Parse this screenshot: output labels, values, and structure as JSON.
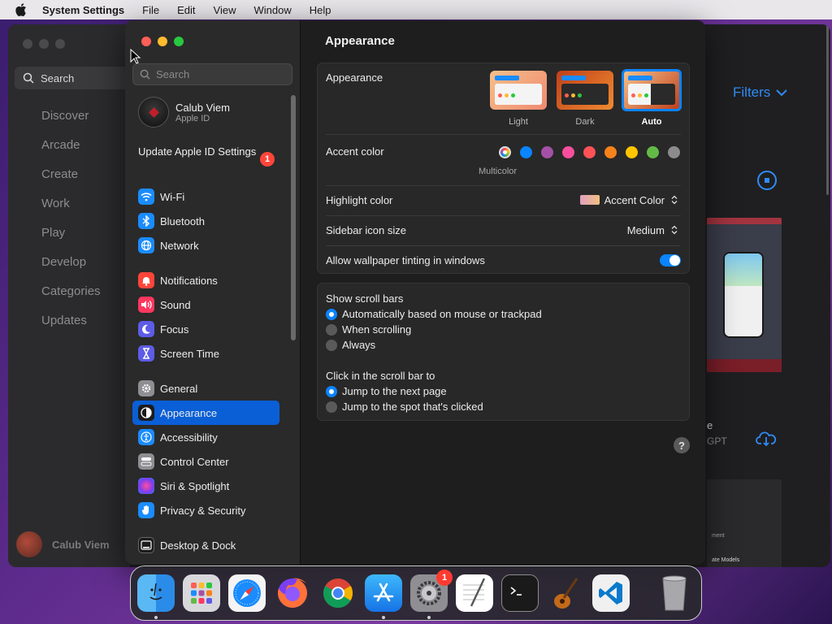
{
  "menubar": {
    "app_name": "System Settings",
    "items": [
      "File",
      "Edit",
      "View",
      "Window",
      "Help"
    ]
  },
  "background_window": {
    "search_label": "Search",
    "nav": [
      "Discover",
      "Arcade",
      "Create",
      "Work",
      "Play",
      "Develop",
      "Categories",
      "Updates"
    ],
    "user_name": "Calub Viem",
    "filters_label": "Filters",
    "partial_text_1": "e",
    "partial_text_2": "GPT",
    "card_text_1": "ment",
    "card_text_2": "ate Models"
  },
  "sidebar": {
    "search_placeholder": "Search",
    "profile": {
      "name": "Calub Viem",
      "subtitle": "Apple ID"
    },
    "update": {
      "label": "Update Apple ID Settings",
      "badge": "1"
    },
    "group1": [
      {
        "label": "Wi-Fi",
        "icon": "wifi-icon",
        "color": "#1a8cff"
      },
      {
        "label": "Bluetooth",
        "icon": "bluetooth-icon",
        "color": "#1a8cff"
      },
      {
        "label": "Network",
        "icon": "globe-icon",
        "color": "#1a8cff"
      }
    ],
    "group2": [
      {
        "label": "Notifications",
        "icon": "bell-icon",
        "color": "#ff453a"
      },
      {
        "label": "Sound",
        "icon": "speaker-icon",
        "color": "#ff375f"
      },
      {
        "label": "Focus",
        "icon": "moon-icon",
        "color": "#5e5ce6"
      },
      {
        "label": "Screen Time",
        "icon": "hourglass-icon",
        "color": "#5e5ce6"
      }
    ],
    "group3": [
      {
        "label": "General",
        "icon": "gear-icon",
        "color": "#8e8e93"
      },
      {
        "label": "Appearance",
        "icon": "appearance-icon",
        "color": "#1c1c1e",
        "selected": true
      },
      {
        "label": "Accessibility",
        "icon": "accessibility-icon",
        "color": "#1a8cff"
      },
      {
        "label": "Control Center",
        "icon": "control-center-icon",
        "color": "#8e8e93"
      },
      {
        "label": "Siri & Spotlight",
        "icon": "siri-icon",
        "color": "#7d3cf0"
      },
      {
        "label": "Privacy & Security",
        "icon": "hand-icon",
        "color": "#1a8cff"
      }
    ],
    "group4": [
      {
        "label": "Desktop & Dock",
        "icon": "dock-icon",
        "color": "#1c1c1e"
      }
    ]
  },
  "content": {
    "title": "Appearance",
    "appearance": {
      "label": "Appearance",
      "options": [
        {
          "label": "Light",
          "selected": false
        },
        {
          "label": "Dark",
          "selected": false
        },
        {
          "label": "Auto",
          "selected": true
        }
      ]
    },
    "accent": {
      "label": "Accent color",
      "multicolor_label": "Multicolor",
      "colors": [
        "#a0a0ff",
        "#0a84ff",
        "#a550a7",
        "#f74f9e",
        "#ff5257",
        "#f7821b",
        "#ffc600",
        "#62ba46",
        "#8c8c8c"
      ]
    },
    "highlight": {
      "label": "Highlight color",
      "value": "Accent Color"
    },
    "sidebar_icon_size": {
      "label": "Sidebar icon size",
      "value": "Medium"
    },
    "wallpaper_tinting": {
      "label": "Allow wallpaper tinting in windows",
      "enabled": true
    },
    "scroll_bars": {
      "label": "Show scroll bars",
      "options": [
        {
          "label": "Automatically based on mouse or trackpad",
          "selected": true
        },
        {
          "label": "When scrolling",
          "selected": false
        },
        {
          "label": "Always",
          "selected": false
        }
      ]
    },
    "click_scroll": {
      "label": "Click in the scroll bar to",
      "options": [
        {
          "label": "Jump to the next page",
          "selected": true
        },
        {
          "label": "Jump to the spot that's clicked",
          "selected": false
        }
      ]
    },
    "help_label": "?"
  },
  "dock": {
    "items": [
      "Finder",
      "Launchpad",
      "Safari",
      "Firefox",
      "Chrome",
      "App Store",
      "System Settings",
      "TextEdit",
      "Terminal",
      "GarageBand",
      "Visual Studio Code",
      "Trash"
    ],
    "settings_badge": "1"
  }
}
